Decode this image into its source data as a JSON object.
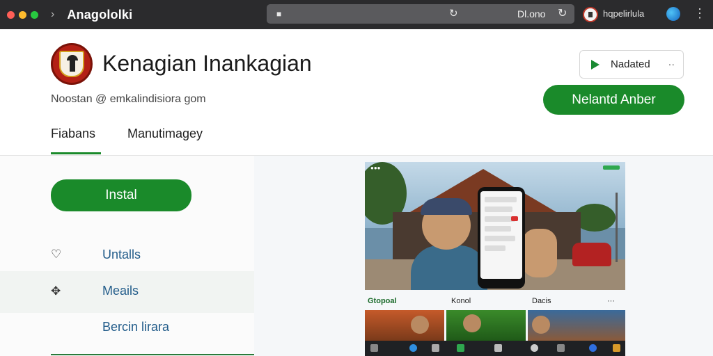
{
  "window": {
    "title": "Anagololki",
    "url": "Dl.ono",
    "profile_label": "hqpelirlula",
    "traffic_light_colors": [
      "#ff5f57",
      "#febc2e",
      "#28c840"
    ]
  },
  "app": {
    "name": "Kenagian Inankagian",
    "developer_line": "Noostan @ emkalindisiora gom",
    "wishlist_label": "Nadated",
    "secondary_cta": "Nelantd Anber",
    "install_label": "Instal",
    "accent_color": "#1a8a2a"
  },
  "tabs": [
    {
      "label": "Fiabans",
      "active": true
    },
    {
      "label": "Manutimagey",
      "active": false
    }
  ],
  "sidebar": {
    "items": [
      {
        "icon": "heart-icon",
        "label": "Untalls"
      },
      {
        "icon": "share-icon",
        "label": "Meails"
      },
      {
        "icon": "",
        "label": "Bercin lirara"
      }
    ]
  },
  "media": {
    "captions": [
      "Gtopoal",
      "Konol",
      "Dacis"
    ],
    "more": "···"
  }
}
